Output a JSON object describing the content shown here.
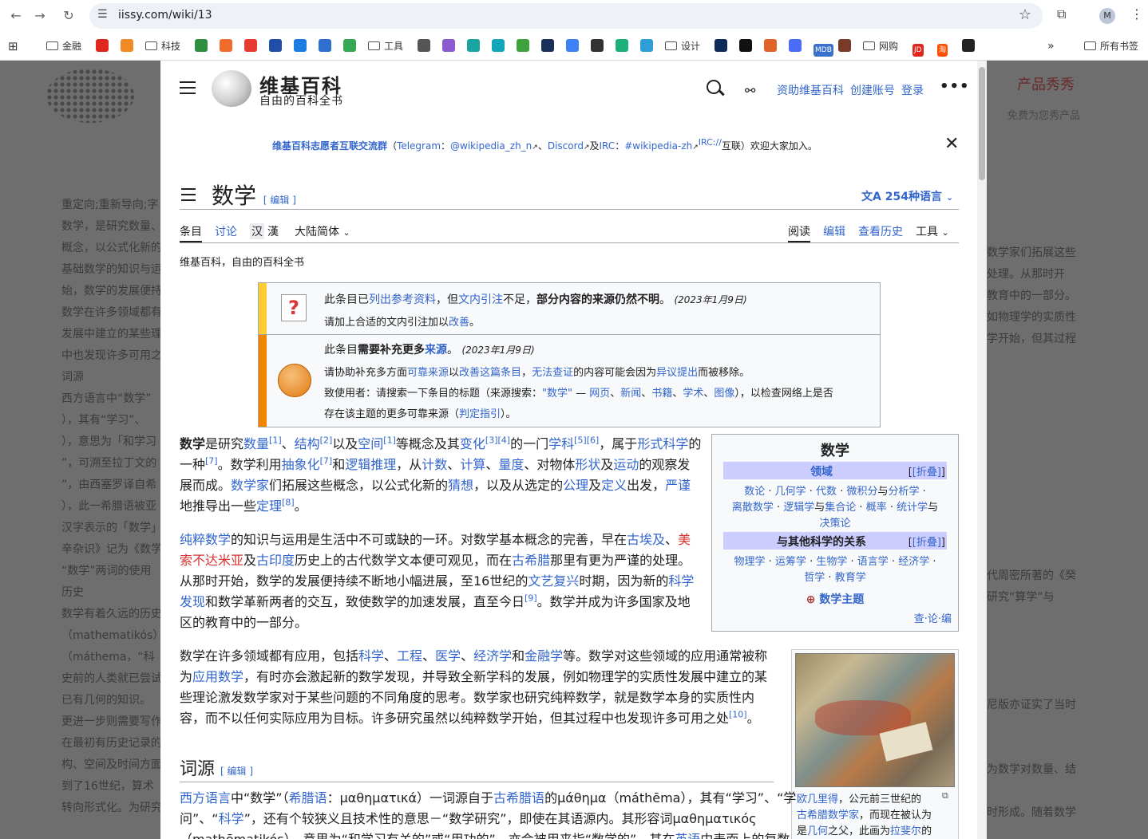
{
  "browser": {
    "url": "iissy.com/wiki/13",
    "avatar": "M",
    "bookmarks": [
      {
        "label": "金融",
        "type": "folder"
      },
      {
        "label": "",
        "type": "site",
        "color": "#e0281c"
      },
      {
        "label": "",
        "type": "site",
        "color": "#f08a24"
      },
      {
        "label": "科技",
        "type": "folder"
      },
      {
        "label": "",
        "type": "site",
        "color": "#2d8f3f"
      },
      {
        "label": "",
        "type": "site",
        "color": "#ef6c2a"
      },
      {
        "label": "",
        "type": "site",
        "color": "#e63b2e"
      },
      {
        "label": "",
        "type": "site",
        "color": "#1f4fa8"
      },
      {
        "label": "",
        "type": "site",
        "color": "#1c7ce0"
      },
      {
        "label": "",
        "type": "site",
        "color": "#2f6fd0"
      },
      {
        "label": "",
        "type": "site",
        "color": "#34a853"
      },
      {
        "label": "工具",
        "type": "folder"
      },
      {
        "label": "",
        "type": "site",
        "color": "#555555"
      },
      {
        "label": "",
        "type": "site",
        "color": "#8a5cd0"
      },
      {
        "label": "",
        "type": "site",
        "color": "#1aa6a0"
      },
      {
        "label": "",
        "type": "site",
        "color": "#12a6b8"
      },
      {
        "label": "",
        "type": "site",
        "color": "#3da33d"
      },
      {
        "label": "",
        "type": "site",
        "color": "#1a2f5a"
      },
      {
        "label": "",
        "type": "site",
        "color": "#3b82f6"
      },
      {
        "label": "",
        "type": "site",
        "color": "#333333"
      },
      {
        "label": "",
        "type": "site",
        "color": "#1db07a"
      },
      {
        "label": "",
        "type": "site",
        "color": "#2f9ed8"
      },
      {
        "label": "设计",
        "type": "folder"
      },
      {
        "label": "",
        "type": "site",
        "color": "#0c2a5a"
      },
      {
        "label": "",
        "type": "site",
        "color": "#111111"
      },
      {
        "label": "",
        "type": "site",
        "color": "#e0632a"
      },
      {
        "label": "",
        "type": "site",
        "color": "#4a6cf7"
      },
      {
        "label": "MDB",
        "type": "site",
        "color": "#3b71ca"
      },
      {
        "label": "",
        "type": "site",
        "color": "#7a3a2a"
      },
      {
        "label": "网购",
        "type": "folder"
      },
      {
        "label": "JD",
        "type": "site",
        "color": "#e1251b"
      },
      {
        "label": "淘",
        "type": "site",
        "color": "#ff5000"
      },
      {
        "label": "",
        "type": "site",
        "color": "#222222"
      }
    ],
    "bookmarks_more": "»",
    "all_bookmarks": "所有书签"
  },
  "bgsite": {
    "right_title": "产品秀秀",
    "right_sub": "免费为您秀产品",
    "left_lines": [
      "重定向;重新导向;字",
      "数学，是研究数量、",
      "概念，以公式化新的",
      "基础数学的知识与运",
      "始，数学的发展便持",
      "数学在许多领域都有",
      "发展中建立的某些理",
      "中也发现许多可用之",
      "词源",
      "西方语言中“数学”",
      "），其有“学习”、",
      "），意思为「和学习",
      "”，可溯至拉丁文的",
      "”，由西塞罗译自希",
      "），此一希腊语被亚",
      "汉字表示的「数学」",
      "辛杂识》记为《数学",
      "“数学”两词的使用",
      "历史",
      "数学有着久远的历史",
      "（mathematikós）",
      "（máthema，“科",
      "史前的人类就已尝试",
      "已有几何的知识。",
      "更进一步则需要写作",
      "在最初有历史记录的",
      "构、空间及时间方面",
      "到了16世纪，算术",
      "转向形式化。为研究"
    ],
    "right_lines": [
      "数学家们拓展这些",
      "处理。从那时开",
      "教育中的一部分。",
      "如物理学的实质性",
      "学开始，但其过程",
      "",
      "",
      "",
      "",
      "",
      "",
      "",
      "",
      "",
      "",
      "代周密所著的《癸",
      "研究“算学”与",
      "",
      "",
      "",
      "",
      "尼版亦证实了当时",
      "",
      "",
      "为数学对数量、结",
      "",
      "时形成。随着数学",
      ""
    ]
  },
  "wiki": {
    "site_title": "维基百科",
    "site_tagline": "自由的百科全书",
    "header_links": [
      "资助维基百科",
      "创建账号",
      "登录"
    ],
    "banner": {
      "group": "维基百科志愿者互联交流群",
      "telegram_label": "Telegram",
      "telegram": "@wikipedia_zh_n",
      "discord": "Discord",
      "and": "及",
      "irc_label": "IRC",
      "irc": "#wikipedia-zh",
      "irc_sup": "IRC://",
      "tail": "互联）欢迎大家加入。"
    },
    "page_title": "数学",
    "edit_label": "[ 编辑 ]",
    "languages": "254种语言",
    "tabs_left": [
      "条目",
      "讨论"
    ],
    "variant_han": "汉",
    "variant_han2": "漢",
    "variant_label": "大陆简体",
    "tabs_right": [
      "阅读",
      "编辑",
      "查看历史",
      "工具"
    ],
    "tagline": "维基百科，自由的百科全书",
    "ambox1": {
      "line1_a": "此条目已",
      "line1_link1": "列出参考资料",
      "line1_b": "，但",
      "line1_link2": "文内引注",
      "line1_c": "不足，",
      "line1_bold": "部分内容的来源仍然不明",
      "line1_d": "。",
      "date": "(2023年1月9日)",
      "line2_a": "请加上合适的文内引注加以",
      "line2_link": "改善",
      "line2_b": "。"
    },
    "ambox2": {
      "l1_a": "此条目",
      "l1_bold": "需要补充更多",
      "l1_link": "来源",
      "l1_b": "。",
      "date": "(2023年1月9日)",
      "l2": [
        "请协助补充多方面",
        "可靠来源",
        "以",
        "改善这篇条目",
        "，",
        "无法查证",
        "的内容可能会因为",
        "异议提出",
        "而被移除。"
      ],
      "l3": [
        "致使用者：请搜索一下条目的标题（来源搜索：",
        "\"数学\"",
        " — ",
        "网页",
        "、",
        "新闻",
        "、",
        "书籍",
        "、",
        "学术",
        "、",
        "图像",
        "），以检查网络上是否"
      ],
      "l4": [
        "存在该主题的更多可靠来源（",
        "判定指引",
        "）。"
      ]
    },
    "p1": {
      "lines": [
        [
          {
            "b": "数学"
          },
          {
            "t": "是研究"
          },
          {
            "l": "数量"
          },
          {
            "s": "[1]"
          },
          {
            "t": "、"
          },
          {
            "l": "结构"
          },
          {
            "s": "[2]"
          },
          {
            "t": "以及"
          },
          {
            "l": "空间"
          },
          {
            "s": "[1]"
          },
          {
            "t": "等概念及其"
          },
          {
            "l": "变化"
          },
          {
            "s": "[3][4]"
          },
          {
            "t": "的一门"
          },
          {
            "l": "学科"
          },
          {
            "s": "[5][6]"
          },
          {
            "t": "，属于"
          },
          {
            "l": "形式科学"
          },
          {
            "t": "的"
          }
        ],
        [
          {
            "t": "一种"
          },
          {
            "s": "[7]"
          },
          {
            "t": "。数学利用"
          },
          {
            "l": "抽象化"
          },
          {
            "s": "[7]"
          },
          {
            "t": "和"
          },
          {
            "l": "逻辑推理"
          },
          {
            "t": "，从"
          },
          {
            "l": "计数"
          },
          {
            "t": "、"
          },
          {
            "l": "计算"
          },
          {
            "t": "、"
          },
          {
            "l": "量度"
          },
          {
            "t": "、对物体"
          },
          {
            "l": "形状"
          },
          {
            "t": "及"
          },
          {
            "l": "运动"
          },
          {
            "t": "的观察发"
          }
        ],
        [
          {
            "t": "展而成。"
          },
          {
            "l": "数学家"
          },
          {
            "t": "们拓展这些概念，以公式化新的"
          },
          {
            "l": "猜想"
          },
          {
            "t": "，以及从选定的"
          },
          {
            "l": "公理"
          },
          {
            "t": "及"
          },
          {
            "l": "定义"
          },
          {
            "t": "出发，"
          },
          {
            "l": "严谨"
          }
        ],
        [
          {
            "t": "地推导出一些"
          },
          {
            "l": "定理"
          },
          {
            "s": "[8]"
          },
          {
            "t": "。"
          }
        ]
      ]
    },
    "p2": {
      "lines": [
        [
          {
            "l": "纯粹数学"
          },
          {
            "t": "的知识与运用是生活中不可或缺的一环。对数学基本概念的完善，早在"
          },
          {
            "l": "古埃及"
          },
          {
            "t": "、"
          },
          {
            "r": "美"
          }
        ],
        [
          {
            "r": "索不达米亚"
          },
          {
            "t": "及"
          },
          {
            "l": "古印度"
          },
          {
            "t": "历史上的古代数学文本便可观见，而在"
          },
          {
            "l": "古希腊"
          },
          {
            "t": "那里有更为严谨的处理。"
          }
        ],
        [
          {
            "t": "从那时开始，数学的发展便持续不断地小幅进展，至16世纪的"
          },
          {
            "l": "文艺复兴"
          },
          {
            "t": "时期，因为新的"
          },
          {
            "l": "科学"
          }
        ],
        [
          {
            "l": "发现"
          },
          {
            "t": "和数学革新两者的交互，致使数学的加速发展，直至今日"
          },
          {
            "s": "[9]"
          },
          {
            "t": "。数学并成为许多国家及地"
          }
        ],
        [
          {
            "t": "区的教育中的一部分。"
          }
        ]
      ]
    },
    "p3": {
      "lines": [
        [
          {
            "t": "数学在许多领域都有应用，包括"
          },
          {
            "l": "科学"
          },
          {
            "t": "、"
          },
          {
            "l": "工程"
          },
          {
            "t": "、"
          },
          {
            "l": "医学"
          },
          {
            "t": "、"
          },
          {
            "l": "经济学"
          },
          {
            "t": "和"
          },
          {
            "l": "金融学"
          },
          {
            "t": "等。数学对这些领域的应用通常被称"
          }
        ],
        [
          {
            "t": "为"
          },
          {
            "l": "应用数学"
          },
          {
            "t": "，有时亦会激起新的数学发现，并导致全新学科的发展，例如物理学的实质性发展中建立的某"
          }
        ],
        [
          {
            "t": "些理论激发数学家对于某些问题的不同角度的思考。数学家也研究纯粹数学，就是数学本身的实质性内"
          }
        ],
        [
          {
            "t": "容，而不以任何实际应用为目标。许多研究虽然以纯粹数学开始，但其过程中也发现许多可用之处"
          },
          {
            "s": "[10]"
          },
          {
            "t": "。"
          }
        ]
      ]
    },
    "infobox": {
      "title": "数学",
      "sec1": "领域",
      "fold": "[折叠]",
      "sec1_items": [
        [
          {
            "l": "数论"
          },
          {
            "t": " · "
          },
          {
            "l": "几何学"
          },
          {
            "t": " · "
          },
          {
            "l": "代数"
          },
          {
            "t": " · "
          },
          {
            "l": "微积分"
          },
          {
            "t": "与"
          },
          {
            "l": "分析学"
          },
          {
            "t": " ·"
          }
        ],
        [
          {
            "l": "离散数学"
          },
          {
            "t": " · "
          },
          {
            "l": "逻辑学"
          },
          {
            "t": "与"
          },
          {
            "l": "集合论"
          },
          {
            "t": " · "
          },
          {
            "l": "概率"
          },
          {
            "t": " · "
          },
          {
            "l": "统计学"
          },
          {
            "t": "与"
          }
        ],
        [
          {
            "l": "决策论"
          }
        ]
      ],
      "sec2": "与其他科学的关系",
      "sec2_items": [
        [
          {
            "l": "物理学"
          },
          {
            "t": " · "
          },
          {
            "l": "运筹学"
          },
          {
            "t": " · "
          },
          {
            "l": "生物学"
          },
          {
            "t": " · "
          },
          {
            "l": "语言学"
          },
          {
            "t": " · "
          },
          {
            "l": "经济学"
          },
          {
            "t": " ·"
          }
        ],
        [
          {
            "l": "哲学"
          },
          {
            "t": " · "
          },
          {
            "l": "教育学"
          }
        ]
      ],
      "portal": "数学主题",
      "vte": "查·论·编"
    },
    "section2_title": "词源",
    "section2_edit": "[ 编辑 ]",
    "p4": {
      "lines": [
        [
          {
            "l": "西方语言"
          },
          {
            "t": "中“数学”（"
          },
          {
            "l": "希腊语"
          },
          {
            "t": "：μαθηματικά）一词源自于"
          },
          {
            "l": "古希腊语"
          },
          {
            "t": "的μάθημα（máthēma），其有“学习”、“学"
          }
        ],
        [
          {
            "t": "问”、“"
          },
          {
            "l": "科学"
          },
          {
            "t": "”，还有个较狭义且技术性的意思－“数学研究”，即使在其语源内。其形容词μαθηματικός"
          }
        ],
        [
          {
            "t": "（mathēmatikós），意思为“和学习有关的”或“用功的”，亦会被用来指“数学的”。其在"
          },
          {
            "l": "英语"
          },
          {
            "t": "中表面上的复数"
          }
        ]
      ]
    },
    "thumb_caption": [
      [
        {
          "l": "欧几里得"
        },
        {
          "t": "，公元前三世纪的"
        }
      ],
      [
        {
          "l": "古希腊数学家"
        },
        {
          "t": "，而现在被认为"
        }
      ],
      [
        {
          "t": "是"
        },
        {
          "l": "几何"
        },
        {
          "t": "之父，此画为"
        },
        {
          "l": "拉斐尔"
        },
        {
          "t": "的"
        }
      ]
    ]
  }
}
